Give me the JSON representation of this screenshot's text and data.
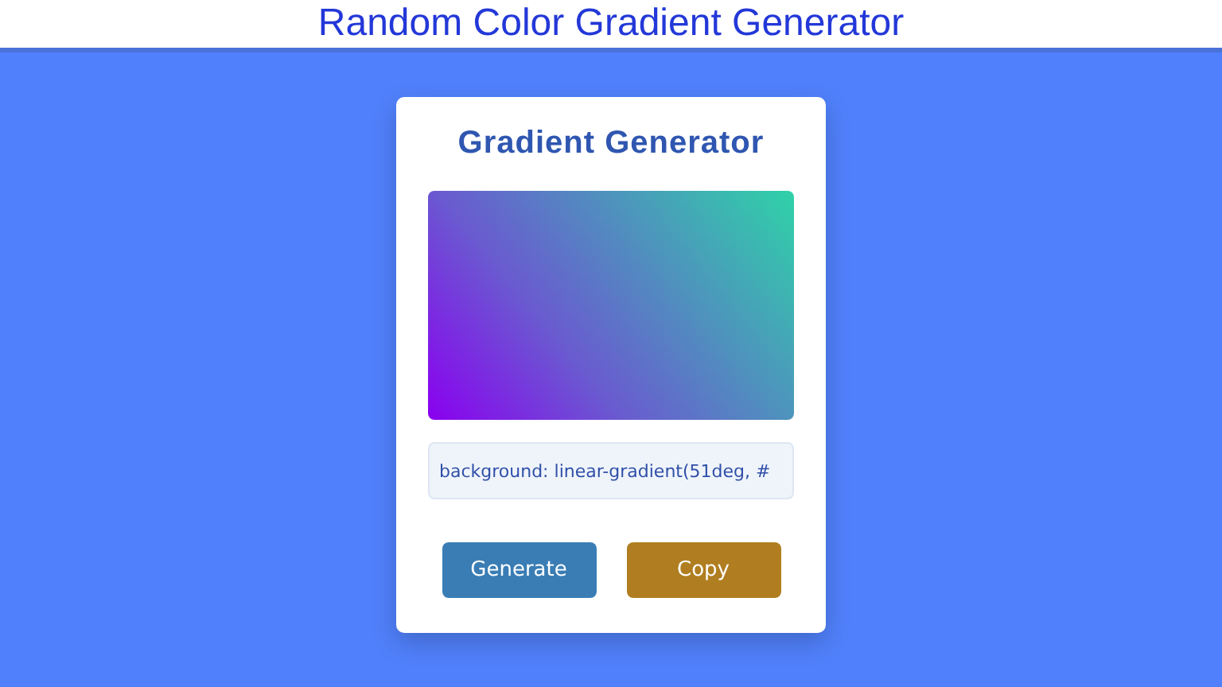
{
  "page_title": "Random Color Gradient Generator",
  "card": {
    "title": "Gradient Generator",
    "code_field": {
      "value": "background: linear-gradient(51deg, #"
    },
    "buttons": [
      {
        "label": "Generate",
        "kind": "generate"
      },
      {
        "label": "Copy",
        "kind": "copy"
      }
    ]
  }
}
